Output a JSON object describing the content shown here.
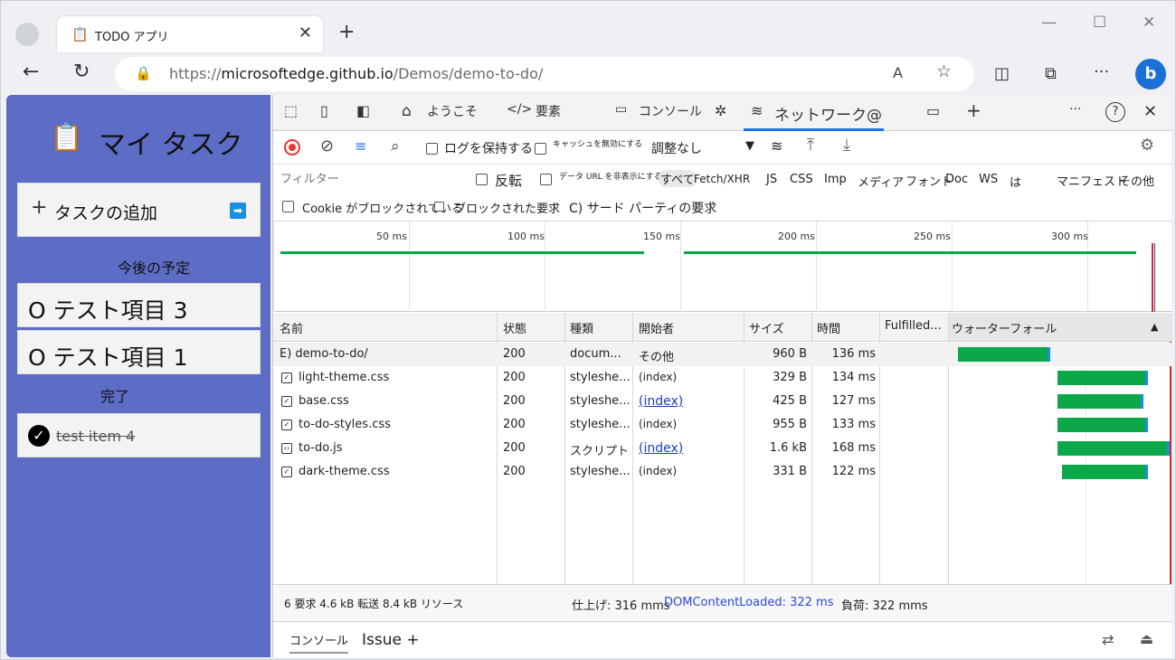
{
  "browser": {
    "tab_title": "TODO アプリ",
    "url_prefix": "https://",
    "url_host": "microsoftedge.github.io",
    "url_path": "/Demos/demo-to-do/"
  },
  "todo": {
    "title": "マイ タスク",
    "add_label": "タスクの追加",
    "upcoming_heading": "今後の予定",
    "items": [
      "O テスト項目 3",
      "O テスト項目 1"
    ],
    "done_heading": "完了",
    "done_items": [
      "test item 4"
    ]
  },
  "devtools": {
    "tabs": [
      "ようこそ",
      "要素",
      "コンソール",
      "ネットワーク@"
    ],
    "toolbar": {
      "preserve_log": "ログを保持する",
      "disable_cache": "キャッシュを無効にする",
      "throttle": "調整なし"
    },
    "filter": {
      "placeholder": "フィルター",
      "invert": "反転",
      "hide_data_urls": "データ URL を非表示にする",
      "types": [
        "すべて",
        "Fetch/XHR",
        "JS",
        "CSS",
        "Imp",
        "メディア",
        "フォント",
        "Doc",
        "WS",
        "は",
        "マニフェスト",
        "その他"
      ],
      "blocked_cookies": "Cookie がブロックされている",
      "blocked_requests": "ブロックされた要求",
      "third_party": "C) サード パーティの要求"
    },
    "overview_ticks": [
      "50 ms",
      "100 ms",
      "150 ms",
      "200 ms",
      "250 ms",
      "300 ms"
    ],
    "columns": [
      "名前",
      "状態",
      "種類",
      "開始者",
      "サイズ",
      "時間",
      "Fulfilled...",
      "ウォーターフォール"
    ],
    "rows": [
      {
        "name": "E) demo-to-do/",
        "status": "200",
        "type": "docum...",
        "initiator": "その他",
        "size": "960 B",
        "time": "136 ms",
        "icon": "document-icon",
        "wf_start": 0.02,
        "wf_end": 0.45
      },
      {
        "name": "light-theme.css",
        "status": "200",
        "type": "styleshe...",
        "initiator": "(index)",
        "size": "329 B",
        "time": "134 ms",
        "icon": "stylesheet-icon",
        "wf_start": 0.48,
        "wf_end": 0.9
      },
      {
        "name": "base.css",
        "status": "200",
        "type": "styleshe...",
        "initiator": "(index)",
        "size": "425 B",
        "time": "127 ms",
        "icon": "stylesheet-icon",
        "wf_start": 0.48,
        "wf_end": 0.88,
        "link": true
      },
      {
        "name": "to-do-styles.css",
        "status": "200",
        "type": "styleshe...",
        "initiator": "(index)",
        "size": "955 B",
        "time": "133 ms",
        "icon": "stylesheet-icon",
        "wf_start": 0.48,
        "wf_end": 0.9
      },
      {
        "name": "to-do.js",
        "status": "200",
        "type": "スクリプト",
        "initiator": "(index)",
        "size": "1.6 kB",
        "time": "168 ms",
        "icon": "script-icon",
        "wf_start": 0.48,
        "wf_end": 1.0,
        "link": true
      },
      {
        "name": "dark-theme.css",
        "status": "200",
        "type": "styleshe...",
        "initiator": "(index)",
        "size": "331 B",
        "time": "122 ms",
        "icon": "stylesheet-icon",
        "wf_start": 0.5,
        "wf_end": 0.9
      }
    ],
    "status_bar": {
      "requests": "6 要求 4.6 kB 転送 8.4 kB リソース",
      "finish": "仕上げ: 316 mms",
      "dcl": "DOMContentLoaded: 322 ms",
      "load": "負荷: 322 mms"
    },
    "drawer": {
      "console": "コンソール",
      "issues": "Issue +"
    }
  }
}
